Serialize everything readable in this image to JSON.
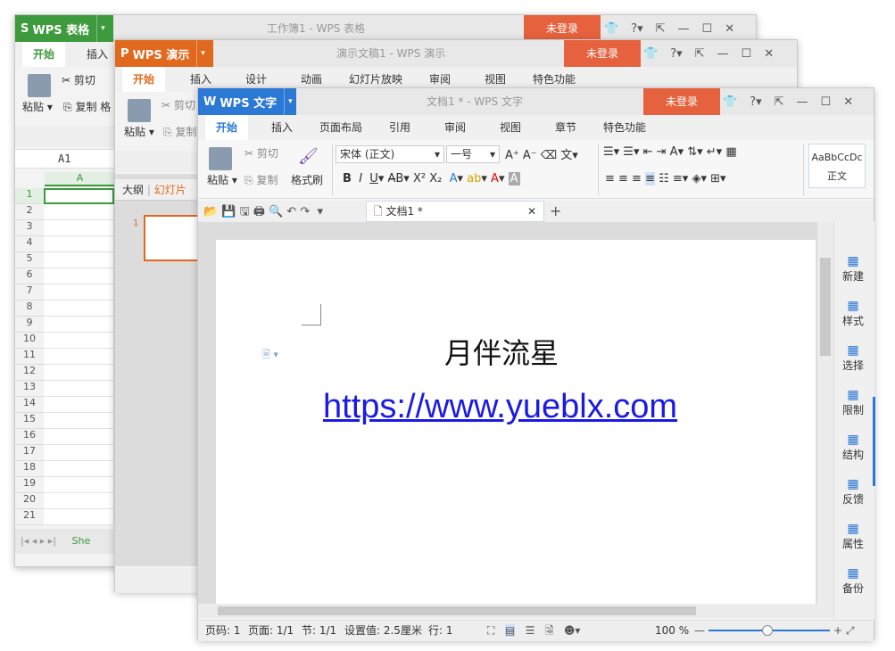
{
  "et": {
    "logo": "WPS 表格",
    "title": "工作簿1 - WPS 表格",
    "login": "未登录",
    "tabs": [
      "开始",
      "插入"
    ],
    "cut": "剪切",
    "paste": "粘贴",
    "copy": "复制",
    "fmt": "格",
    "namebox": "A1",
    "col": "A",
    "rows": [
      "1",
      "2",
      "3",
      "4",
      "5",
      "6",
      "7",
      "8",
      "9",
      "10",
      "11",
      "12",
      "13",
      "14",
      "15",
      "16",
      "17",
      "18",
      "19",
      "20",
      "21"
    ],
    "sheet": "She"
  },
  "wpp": {
    "logo": "WPS 演示",
    "title": "演示文稿1 - WPS 演示",
    "login": "未登录",
    "tabs": [
      "开始",
      "插入",
      "设计",
      "动画",
      "幻灯片放映",
      "审阅",
      "视图",
      "特色功能"
    ],
    "cut": "剪切",
    "paste": "粘贴",
    "copy": "复制",
    "outline": "大纲",
    "slides": "幻灯片",
    "slide_num": "1"
  },
  "wps": {
    "logo": "WPS 文字",
    "title": "文档1 * - WPS 文字",
    "login": "未登录",
    "tabs": [
      "开始",
      "插入",
      "页面布局",
      "引用",
      "审阅",
      "视图",
      "章节",
      "特色功能"
    ],
    "cut": "剪切",
    "paste": "粘贴",
    "copy": "复制",
    "format_painter": "格式刷",
    "font": "宋体 (正文)",
    "size": "一号",
    "style_preview": "AaBbCcDc",
    "style_name": "正文",
    "doc_tab": "文档1 *",
    "content_title": "月伴流星",
    "content_link": "https://www.yueblx.com",
    "right_panel": [
      "新建",
      "样式",
      "选择",
      "限制",
      "结构",
      "反馈",
      "属性",
      "备份"
    ],
    "status": {
      "page_num": "页码: 1",
      "pages": "页面: 1/1",
      "section": "节: 1/1",
      "setting": "设置值: 2.5厘米",
      "row": "行: 1",
      "zoom": "100 %"
    }
  },
  "colors": {
    "et": "#3d9a3d",
    "wpp": "#e0691e",
    "wps": "#2b78d5",
    "login": "#e6623e"
  }
}
